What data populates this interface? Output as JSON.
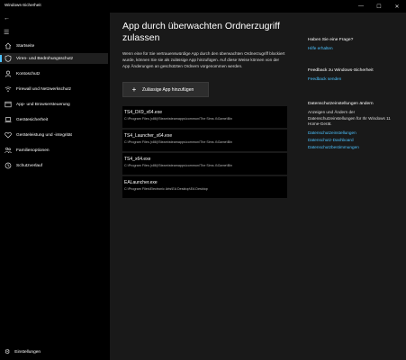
{
  "window": {
    "title": "Windows-Sicherheit",
    "minimize": "—",
    "maximize": "☐",
    "close": "✕"
  },
  "sidebar": {
    "back": "←",
    "menu": "☰",
    "items": [
      {
        "label": "Startseite",
        "icon": "home-icon",
        "active": false
      },
      {
        "label": "Viren- und Bedrohungsschutz",
        "icon": "shield-icon",
        "active": true
      },
      {
        "label": "Kontoschutz",
        "icon": "person-icon",
        "active": false
      },
      {
        "label": "Firewall und Netzwerkschutz",
        "icon": "wifi-icon",
        "active": false
      },
      {
        "label": "App- und Browsersteuerung",
        "icon": "app-window-icon",
        "active": false
      },
      {
        "label": "Gerätesicherheit",
        "icon": "laptop-icon",
        "active": false
      },
      {
        "label": "Geräteleistung und -integrität",
        "icon": "heart-icon",
        "active": false
      },
      {
        "label": "Familienoptionen",
        "icon": "family-icon",
        "active": false
      },
      {
        "label": "Schutzverlauf",
        "icon": "history-icon",
        "active": false
      }
    ],
    "settings_label": "Einstellungen"
  },
  "main": {
    "title": "App durch überwachten Ordnerzugriff zulassen",
    "description": "Wenn eine für Sie vertrauenswürdige App durch den überwachten Ordnerzugriff blockiert wurde, können Sie sie als zulässige App hinzufügen. Auf diese Weise können von der App Änderungen an geschützten Ordnern vorgenommen werden.",
    "add_button": "Zulässige App hinzufügen",
    "apps": [
      {
        "name": "TS4_DX9_x64.exe",
        "path": "C:\\Program Files (x86)\\Steam\\steamapps\\common\\The Sims 4\\Game\\Bin"
      },
      {
        "name": "TS4_Launcher_x64.exe",
        "path": "C:\\Program Files (x86)\\Steam\\steamapps\\common\\The Sims 4\\Game\\Bin"
      },
      {
        "name": "TS4_x64.exe",
        "path": "C:\\Program Files (x86)\\Steam\\steamapps\\common\\The Sims 4\\Game\\Bin"
      },
      {
        "name": "EALauncher.exe",
        "path": "C:\\Program Files\\Electronic Arts\\EA Desktop\\EA Desktop"
      }
    ]
  },
  "right_panel": {
    "question_heading": "Haben Sie eine Frage?",
    "help_link": "Hilfe erhalten",
    "feedback_heading": "Feedback zu Windows-Sicherheit",
    "feedback_link": "Feedback senden",
    "privacy_heading": "Datenschutzeinstellungen ändern",
    "privacy_text": "Anzeigen und Ändern der Datenschutzeinstellungen für Ihr Windows 11 Home-Gerät.",
    "privacy_links": [
      "Datenschutzeinstellungen",
      "Datenschutz-Dashboard",
      "Datenschutzbestimmungen"
    ]
  }
}
